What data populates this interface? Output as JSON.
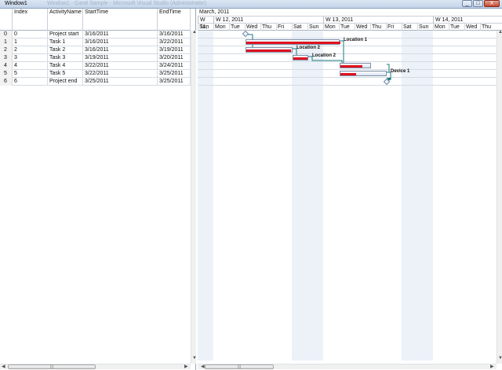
{
  "window": {
    "title": "Window1",
    "ghost_title": "Window1 - Gantt Sample - Microsoft Visual Studio (Administrator)",
    "min": "_",
    "max": "□",
    "close": "X"
  },
  "grid": {
    "headers": [
      "Index",
      "ActivityName",
      "StartTime",
      "EndTime"
    ],
    "rows": [
      {
        "num": "0",
        "index": "0",
        "name": "Project start",
        "start": "3/16/2011",
        "end": "3/16/2011"
      },
      {
        "num": "1",
        "index": "1",
        "name": "Task 1",
        "start": "3/16/2011",
        "end": "3/22/2011"
      },
      {
        "num": "2",
        "index": "2",
        "name": "Task 2",
        "start": "3/16/2011",
        "end": "3/19/2011"
      },
      {
        "num": "3",
        "index": "3",
        "name": "Task 3",
        "start": "3/19/2011",
        "end": "3/20/2011"
      },
      {
        "num": "4",
        "index": "4",
        "name": "Task 4",
        "start": "3/22/2011",
        "end": "3/24/2011"
      },
      {
        "num": "5",
        "index": "5",
        "name": "Task 5",
        "start": "3/22/2011",
        "end": "3/25/2011"
      },
      {
        "num": "6",
        "index": "6",
        "name": "Project end",
        "start": "3/25/2011",
        "end": "3/25/2011"
      }
    ],
    "scroll_grip": "|||"
  },
  "gantt": {
    "month": "March, 2011",
    "weeks": [
      "W 11,",
      "W 12, 2011",
      "W 13, 2011",
      "W 14, 2011"
    ],
    "days": [
      "Sun",
      "Mon",
      "Tue",
      "Wed",
      "Thu",
      "Fri",
      "Sat",
      "Sun",
      "Mon",
      "Tue",
      "Wed",
      "Thu",
      "Fri",
      "Sat",
      "Sun",
      "Mon",
      "Tue",
      "Wed",
      "Thu"
    ],
    "resources": [
      "Location 1",
      "Location 2",
      "Location 2",
      "Device 1"
    ],
    "scroll_grip": "|||"
  }
}
